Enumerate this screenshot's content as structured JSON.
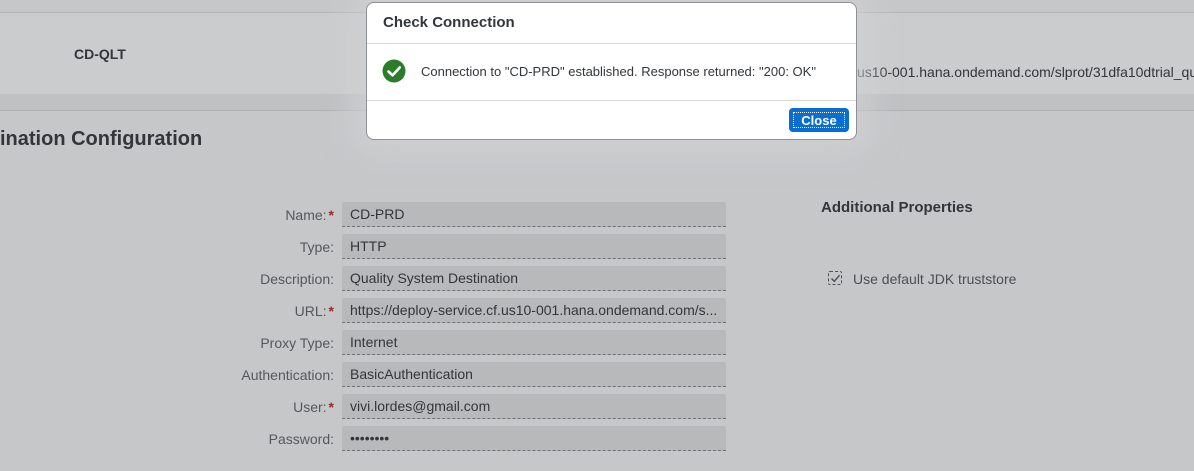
{
  "background_row": {
    "name": "CD-QLT",
    "url": "us10-001.hana.ondemand.com/slprot/31dfa10dtrial_qu"
  },
  "section": {
    "title": "ination Configuration"
  },
  "form": {
    "fields": [
      {
        "label": "Name:",
        "required": true,
        "value": "CD-PRD"
      },
      {
        "label": "Type:",
        "required": false,
        "value": "HTTP"
      },
      {
        "label": "Description:",
        "required": false,
        "value": "Quality System Destination"
      },
      {
        "label": "URL:",
        "required": true,
        "value": "https://deploy-service.cf.us10-001.hana.ondemand.com/s..."
      },
      {
        "label": "Proxy Type:",
        "required": false,
        "value": "Internet"
      },
      {
        "label": "Authentication:",
        "required": false,
        "value": "BasicAuthentication"
      },
      {
        "label": "User:",
        "required": true,
        "value": "vivi.lordes@gmail.com"
      },
      {
        "label": "Password:",
        "required": false,
        "value": "••••••••"
      }
    ],
    "required_marker": "*"
  },
  "additional": {
    "title": "Additional Properties",
    "checkbox_label": "Use default JDK truststore",
    "checkbox_checked": true
  },
  "dialog": {
    "title": "Check Connection",
    "icon": "success-check-icon",
    "message": "Connection to \"CD-PRD\" established. Response returned: \"200: OK\"",
    "close_label": "Close"
  },
  "colors": {
    "accent": "#0a6ed1",
    "success": "#2b7c2b",
    "required": "#a0232c"
  }
}
